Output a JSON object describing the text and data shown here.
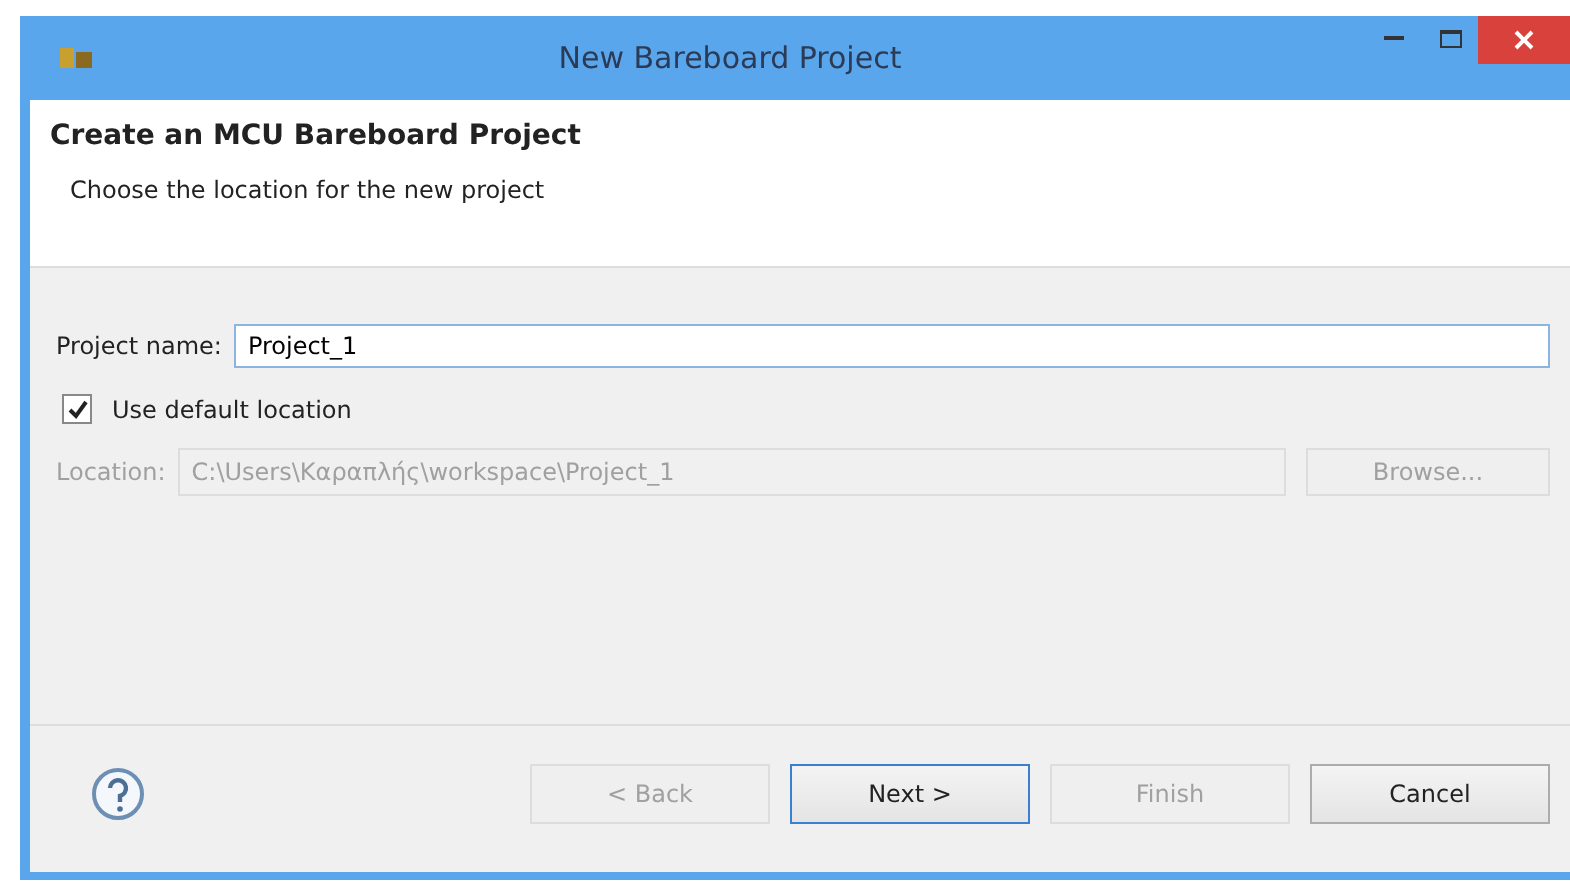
{
  "window": {
    "title": "New Bareboard Project"
  },
  "header": {
    "title": "Create an MCU Bareboard Project",
    "description": "Choose the location for the new project"
  },
  "project_name": {
    "label": "Project name:",
    "value": "Project_1"
  },
  "use_default_location": {
    "label": "Use default location",
    "checked": true
  },
  "location": {
    "label": "Location:",
    "value": "C:\\Users\\Καραπλής\\workspace\\Project_1",
    "disabled": true,
    "browse": "Browse..."
  },
  "buttons": [
    {
      "label": "< Back",
      "disabled": true,
      "default": false
    },
    {
      "label": "Next >",
      "disabled": false,
      "default": true
    },
    {
      "label": "Finish",
      "disabled": true,
      "default": false
    },
    {
      "label": "Cancel",
      "disabled": false,
      "default": false
    }
  ]
}
